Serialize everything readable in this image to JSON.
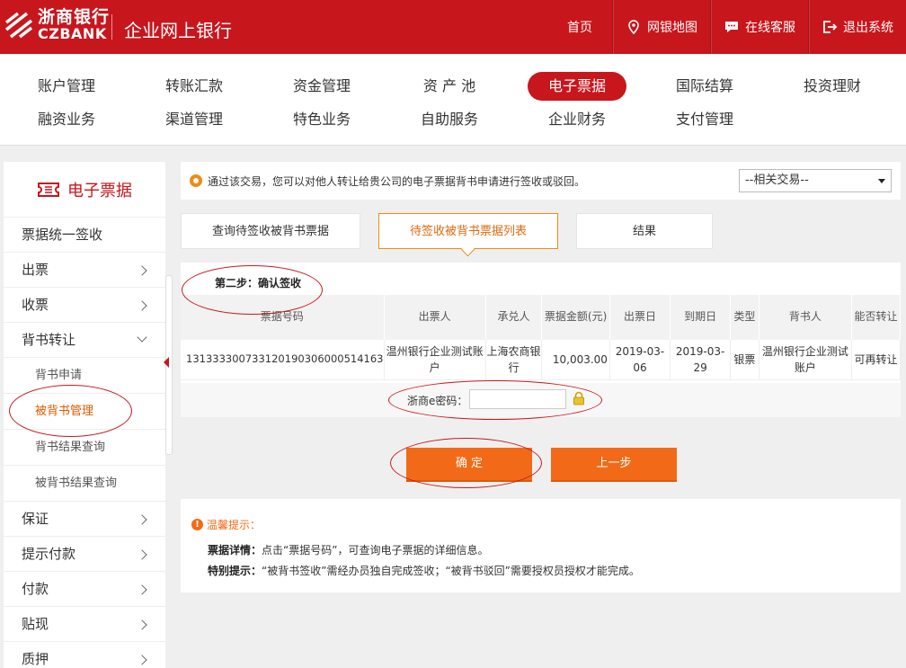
{
  "header": {
    "bank_name_cn": "浙商银行",
    "bank_name_en": "CZBANK",
    "app_title": "企业网上银行",
    "nav": [
      {
        "label": "首页",
        "icon": "none"
      },
      {
        "label": "网银地图",
        "icon": "map-pin-icon"
      },
      {
        "label": "在线客服",
        "icon": "chat-icon"
      },
      {
        "label": "退出系统",
        "icon": "logout-icon"
      }
    ]
  },
  "main_menu": {
    "row1": [
      "账户管理",
      "转账汇款",
      "资金管理",
      "资 产 池",
      "电子票据",
      "国际结算",
      "投资理财"
    ],
    "row2": [
      "融资业务",
      "渠道管理",
      "特色业务",
      "自助服务",
      "企业财务",
      "支付管理"
    ],
    "active": "电子票据"
  },
  "sidebar": {
    "title": "电子票据",
    "items": [
      {
        "label": "票据统一签收"
      },
      {
        "label": "出票"
      },
      {
        "label": "收票"
      },
      {
        "label": "背书转让"
      },
      {
        "label": "背书申请"
      },
      {
        "label": "被背书管理"
      },
      {
        "label": "背书结果查询"
      },
      {
        "label": "被背书结果查询"
      },
      {
        "label": "保证"
      },
      {
        "label": "提示付款"
      },
      {
        "label": "付款"
      },
      {
        "label": "贴现"
      },
      {
        "label": "质押"
      }
    ],
    "active": "被背书管理"
  },
  "info": {
    "text": "通过该交易，您可以对他人转让给贵公司的电子票据背书申请进行签收或驳回。",
    "related_select": "--相关交易--"
  },
  "steps": {
    "tab1": "查询待签收被背书票据",
    "tab2": "待签收被背书票据列表",
    "tab3": "结果"
  },
  "confirm": {
    "step_title": "第二步：确认签收",
    "table": {
      "headers": [
        "票据号码",
        "出票人",
        "承兑人",
        "票据金额(元)",
        "出票日",
        "到期日",
        "类型",
        "背书人",
        "能否转让"
      ],
      "rows": [
        [
          "131333300733120190306000514163",
          "温州银行企业测试账户",
          "上海农商银行",
          "10,003.00",
          "2019-03-06",
          "2019-03-29",
          "银票",
          "温州银行企业测试账户",
          "可再转让"
        ]
      ]
    },
    "password_label": "浙商e密码："
  },
  "buttons": {
    "confirm": "确 定",
    "prev": "上一步"
  },
  "tips": {
    "title": "温馨提示：",
    "line1_label": "票据详情：",
    "line1_text": "点击“票据号码”，可查询电子票据的详细信息。",
    "line2_label": "特别提示：",
    "line2_text": "“被背书签收”需经办员独自完成签收；“被背书驳回”需要授权员授权才能完成。"
  },
  "colors": {
    "brand_red": "#c8161d",
    "accent_orange": "#f26a18"
  }
}
